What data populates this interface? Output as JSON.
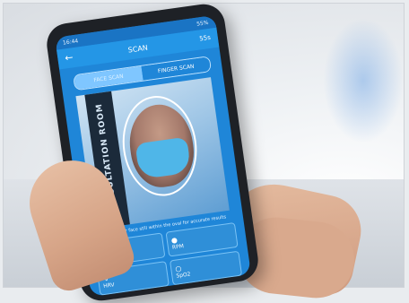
{
  "status_bar": {
    "time": "16:44",
    "battery": "55%"
  },
  "app_bar": {
    "title": "SCAN",
    "timer": "55s"
  },
  "tabs": [
    {
      "label": "FACE SCAN",
      "active": true
    },
    {
      "label": "FINGER SCAN",
      "active": false
    }
  ],
  "camera": {
    "poster_text": "CONSULTATION ROOM"
  },
  "hint": "Keep your face still within the oval for accurate results",
  "metrics": [
    {
      "icon": "heart-icon",
      "label": "BPM"
    },
    {
      "icon": "lungs-icon",
      "label": "RPM"
    },
    {
      "icon": "pulse-icon",
      "label": "HRV"
    },
    {
      "icon": "oxygen-icon",
      "label": "SpO2"
    }
  ],
  "colors": {
    "screen_blue": "#1f86d8",
    "app_bar_blue": "#2496e6",
    "mask_blue": "#4fb6e8"
  }
}
